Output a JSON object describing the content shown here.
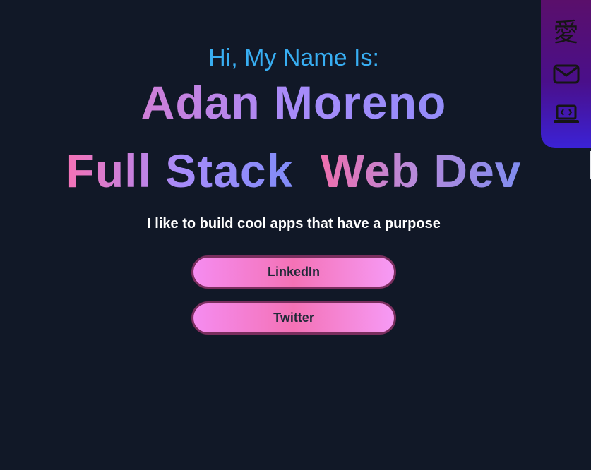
{
  "hero": {
    "greeting": "Hi, My Name Is:",
    "name": "Adan Moreno",
    "role_part1": "Full Stack",
    "role_part2": "Web Dev",
    "tagline": "I like to build cool apps that have a purpose"
  },
  "buttons": {
    "linkedin_label": "LinkedIn",
    "twitter_label": "Twitter"
  },
  "side_nav": {
    "kanji_label": "愛",
    "items": [
      {
        "icon": "kanji-love-icon"
      },
      {
        "icon": "mail-icon"
      },
      {
        "icon": "laptop-code-icon"
      }
    ]
  },
  "colors": {
    "background": "#111827",
    "greeting": "#38aef2",
    "gradient_start": "#f472b6",
    "gradient_end": "#818cf8",
    "button_fill": "#f472b6",
    "button_border": "#7a2e5e",
    "nav_top": "#5a0f6b",
    "nav_bottom": "#3b22d6"
  }
}
